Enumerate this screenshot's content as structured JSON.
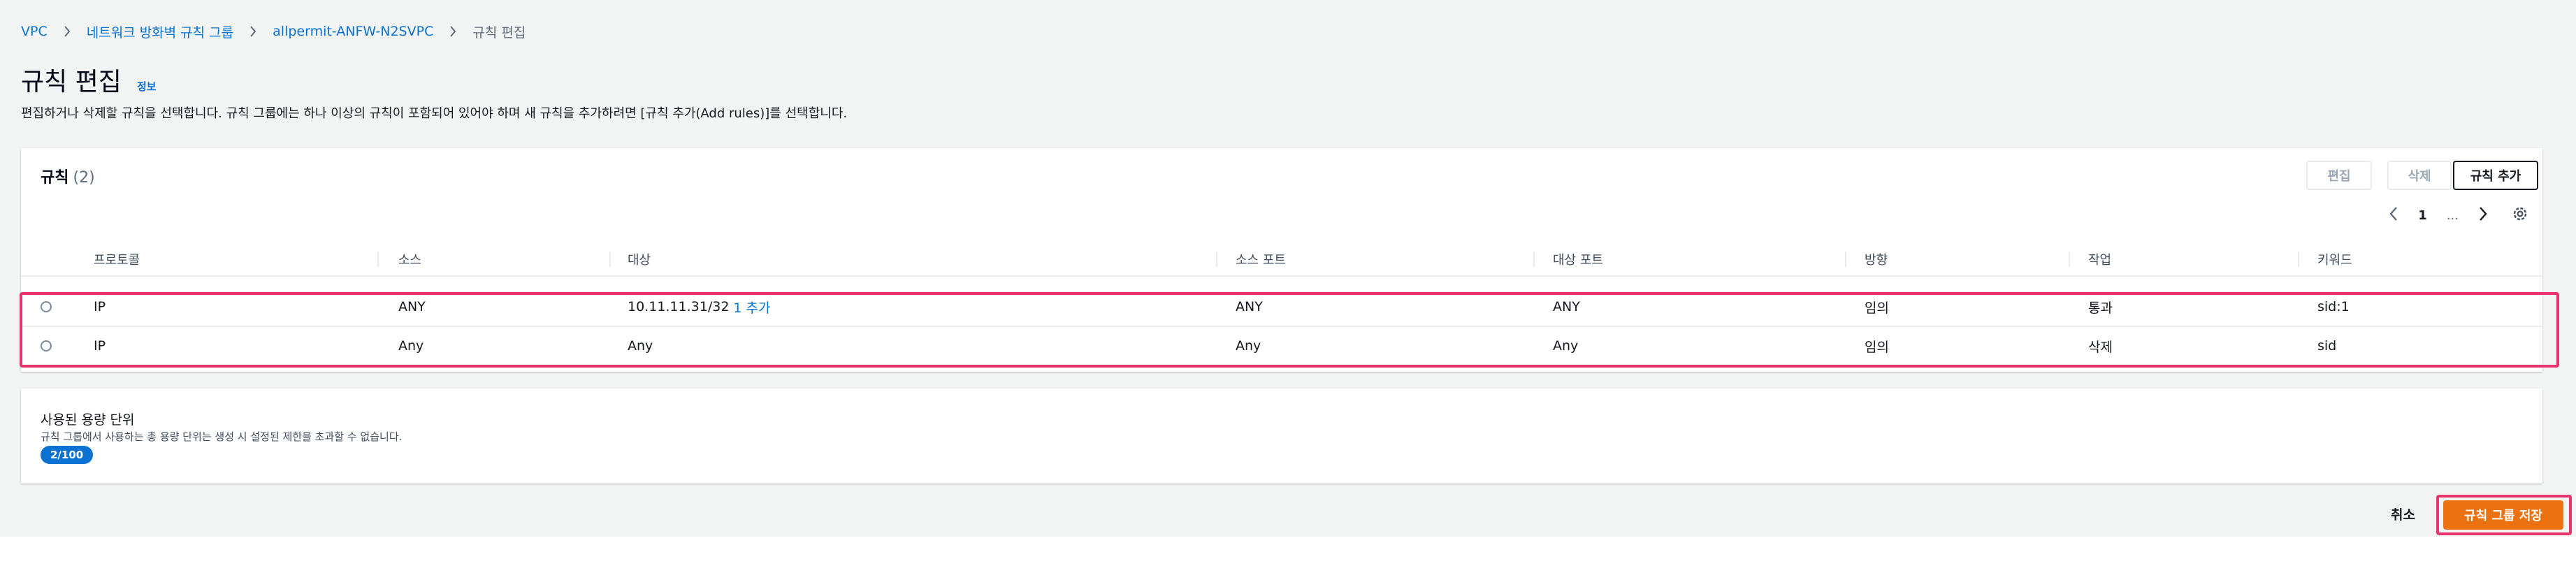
{
  "breadcrumb": [
    {
      "label": "VPC"
    },
    {
      "label": "네트워크 방화벽 규칙 그룹"
    },
    {
      "label": "allpermit-ANFW-N2SVPC"
    },
    {
      "label": "규칙 편집"
    }
  ],
  "header": {
    "title": "규칙 편집",
    "info": "정보",
    "description": "편집하거나 삭제할 규칙을 선택합니다. 규칙 그룹에는 하나 이상의 규칙이 포함되어 있어야 하며 새 규칙을 추가하려면 [규칙 추가(Add rules)]를 선택합니다."
  },
  "rules": {
    "title": "규칙",
    "count": "(2)",
    "buttons": {
      "edit": "편집",
      "delete": "삭제",
      "add": "규칙 추가"
    },
    "pagination": {
      "page": "1",
      "ellipsis": "..."
    },
    "columns": [
      "프로토콜",
      "소스",
      "대상",
      "소스 포트",
      "대상 포트",
      "방향",
      "작업",
      "키워드"
    ],
    "rows": [
      {
        "protocol": "IP",
        "source": "ANY",
        "destination": "10.11.11.31/32",
        "more": "1 추가",
        "source_port": "ANY",
        "dest_port": "ANY",
        "direction": "임의",
        "action": "통과",
        "keyword": "sid:1"
      },
      {
        "protocol": "IP",
        "source": "Any",
        "destination": "Any",
        "more": "",
        "source_port": "Any",
        "dest_port": "Any",
        "direction": "임의",
        "action": "삭제",
        "keyword": "sid"
      }
    ]
  },
  "capacity": {
    "title": "사용된 용량 단위",
    "description": "규칙 그룹에서 사용하는 총 용량 단위는 생성 시 설정된 제한을 초과할 수 없습니다.",
    "value": "2/100"
  },
  "footer": {
    "cancel": "취소",
    "save": "규칙 그룹 저장"
  },
  "colors": {
    "accent": "#0972d3",
    "primary_button": "#ec7211",
    "highlight": "#e8336e"
  }
}
